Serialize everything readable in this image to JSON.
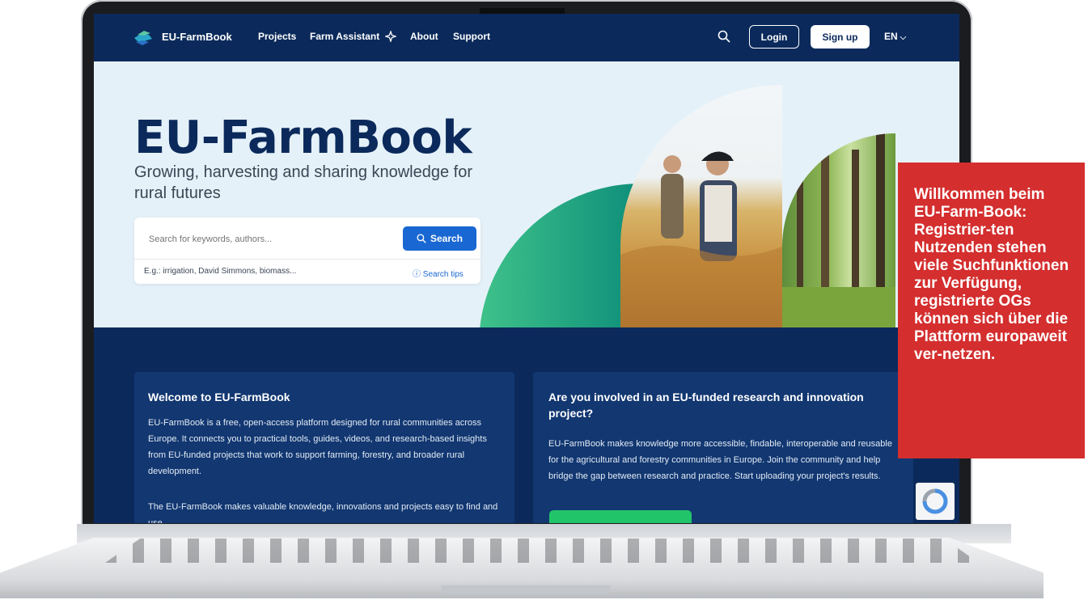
{
  "nav": {
    "brand": "EU-FarmBook",
    "links": [
      "Projects",
      "Farm Assistant",
      "About",
      "Support"
    ],
    "login_label": "Login",
    "signup_label": "Sign up",
    "language": "EN"
  },
  "hero": {
    "title": "EU-FarmBook",
    "subtitle": "Growing, harvesting and sharing knowledge for rural futures",
    "search_placeholder": "Search for keywords, authors...",
    "search_button": "Search",
    "example": "E.g.: irrigation, David Simmons, biomass...",
    "search_tips": "Search tips"
  },
  "welcome": {
    "title": "Welcome to EU-FarmBook",
    "paragraph1": "EU-FarmBook is a free, open-access platform designed for rural communities across Europe. It connects you to practical tools, guides, videos, and research-based insights from EU-funded projects that work to support farming, forestry, and broader rural development.",
    "paragraph2": "The EU-FarmBook makes valuable knowledge, innovations and projects easy to find and use."
  },
  "involved": {
    "title": "Are you involved in an EU-funded research and innovation project?",
    "paragraph": "EU-FarmBook makes knowledge more accessible, findable, interoperable and reusable for the agricultural and forestry communities in Europe. Join the community and help bridge the gap between research and practice. Start uploading your project's results."
  },
  "callout": {
    "text": "Willkommen beim EU-Farm-Book: Registrier-ten Nutzenden stehen viele Suchfunktionen zur Verfügung, registrierte OGs können sich über die Plattform europaweit ver-netzen."
  },
  "colors": {
    "navy": "#0b2a5b",
    "accent_blue": "#1967d2",
    "green": "#22c46a",
    "callout_red": "#d42e2e"
  }
}
